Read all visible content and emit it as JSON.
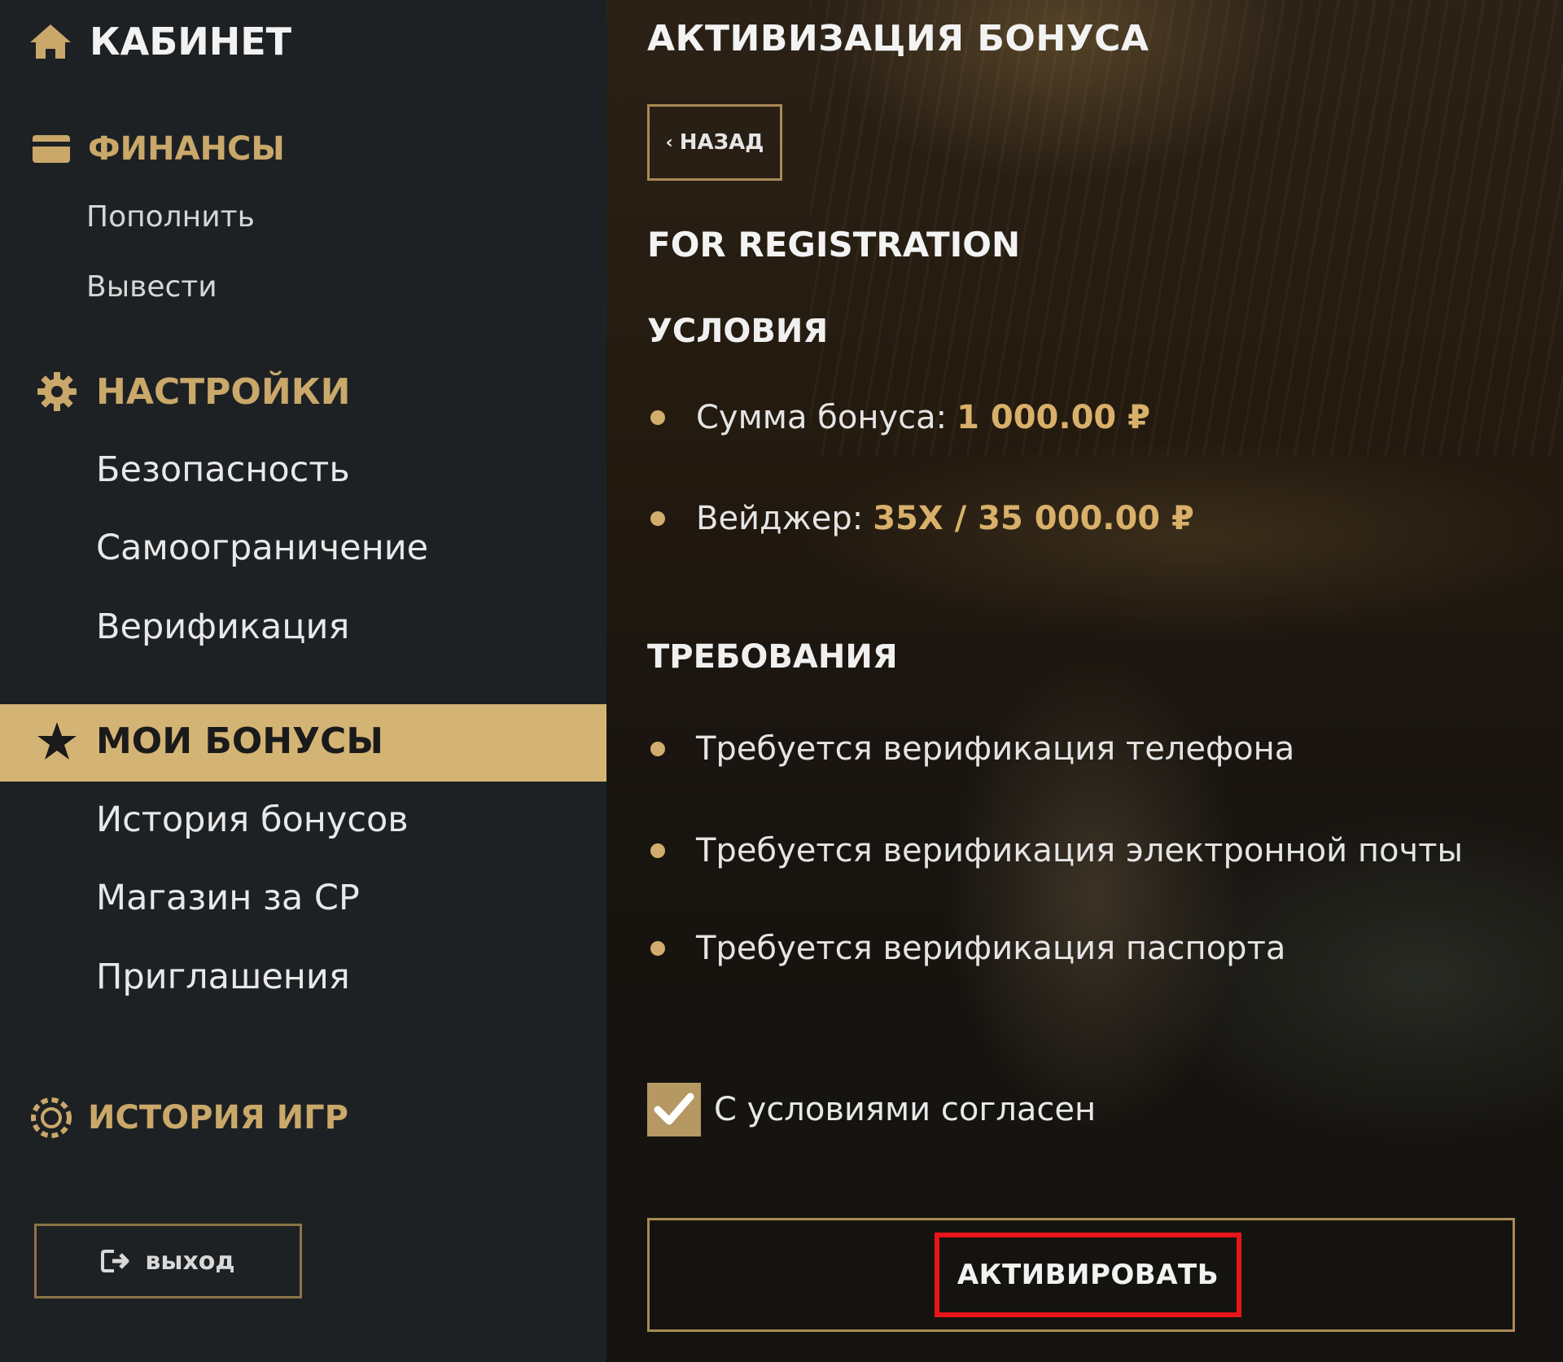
{
  "sidebar": {
    "cabinet": {
      "icon": "home-icon",
      "label": "КАБИНЕТ"
    },
    "finances": {
      "icon": "card-icon",
      "label": "ФИНАНСЫ",
      "items": [
        {
          "label": "Пополнить"
        },
        {
          "label": "Вывести"
        }
      ]
    },
    "settings": {
      "icon": "gear-icon",
      "label": "НАСТРОЙКИ",
      "items": [
        {
          "label": "Безопасность"
        },
        {
          "label": "Самоограничение"
        },
        {
          "label": "Верификация"
        }
      ]
    },
    "bonuses": {
      "icon": "star-icon",
      "label": "МОИ БОНУСЫ",
      "active": true,
      "items": [
        {
          "label": "История бонусов"
        },
        {
          "label": "Магазин за CP"
        },
        {
          "label": "Приглашения"
        }
      ]
    },
    "game_history": {
      "icon": "chip-icon",
      "label": "ИСТОРИЯ ИГР"
    },
    "logout": {
      "icon": "logout-icon",
      "label": "выход"
    }
  },
  "main": {
    "title": "АКТИВИЗАЦИЯ БОНУСА",
    "back": {
      "icon": "chevron-left-icon",
      "label": "НАЗАД"
    },
    "bonus_name": "FOR REGISTRATION",
    "conditions": {
      "title": "УСЛОВИЯ",
      "items": [
        {
          "label": "Сумма бонуса:",
          "value": "1 000.00 ₽"
        },
        {
          "label": "Вейджер:",
          "value": "35X / 35 000.00 ₽"
        }
      ]
    },
    "requirements": {
      "title": "ТРЕБОВАНИЯ",
      "items": [
        {
          "label": "Требуется верификация телефона"
        },
        {
          "label": "Требуется верификация электронной почты"
        },
        {
          "label": "Требуется верификация паспорта"
        }
      ]
    },
    "agree": {
      "label": "С условиями согласен",
      "checked": true
    },
    "activate": {
      "label": "АКТИВИРОВАТЬ"
    }
  },
  "colors": {
    "accent_gold": "#d4b475",
    "sidebar_bg": "#1e2124",
    "highlight_red": "#e8161b"
  }
}
